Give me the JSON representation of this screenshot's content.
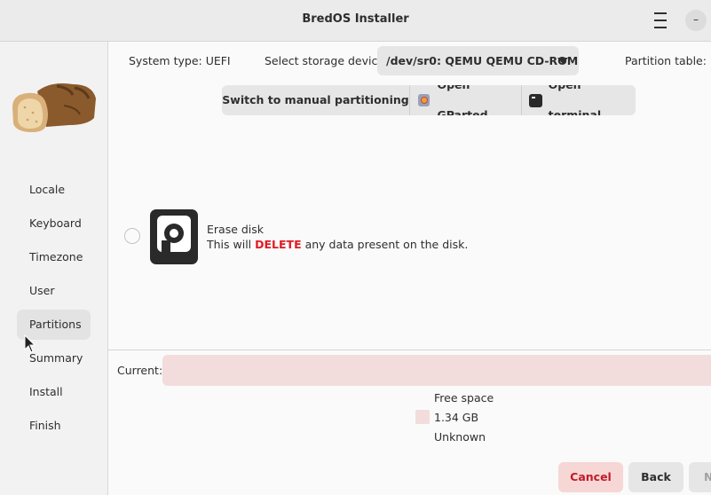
{
  "window": {
    "title": "BredOS Installer",
    "minimize_label": "–"
  },
  "sidebar": {
    "items": [
      {
        "label": "Locale"
      },
      {
        "label": "Keyboard"
      },
      {
        "label": "Timezone"
      },
      {
        "label": "User"
      },
      {
        "label": "Partitions",
        "active": true
      },
      {
        "label": "Summary"
      },
      {
        "label": "Install"
      },
      {
        "label": "Finish"
      }
    ]
  },
  "topbar": {
    "system_type": "System type: UEFI",
    "select_device_label": "Select storage device:",
    "selected_device": "/dev/sr0: QEMU QEMU CD-ROM",
    "partition_table": "Partition table: No"
  },
  "actions": {
    "manual": "Switch to manual partitioning",
    "gparted": "Open GParted",
    "terminal": "Open terminal"
  },
  "erase": {
    "title": "Erase disk",
    "desc_pre": "This will ",
    "desc_warn": "DELETE",
    "desc_post": " any data present on the disk."
  },
  "current": {
    "label": "Current:",
    "partition_name": "Free space",
    "partition_size": "1.34 GB",
    "partition_fs": "Unknown"
  },
  "footer": {
    "cancel": "Cancel",
    "back": "Back",
    "next": "N"
  },
  "colors": {
    "free_space": "#f2dcdc",
    "danger": "#e01b24",
    "cancel_bg": "#f7d6d6"
  }
}
